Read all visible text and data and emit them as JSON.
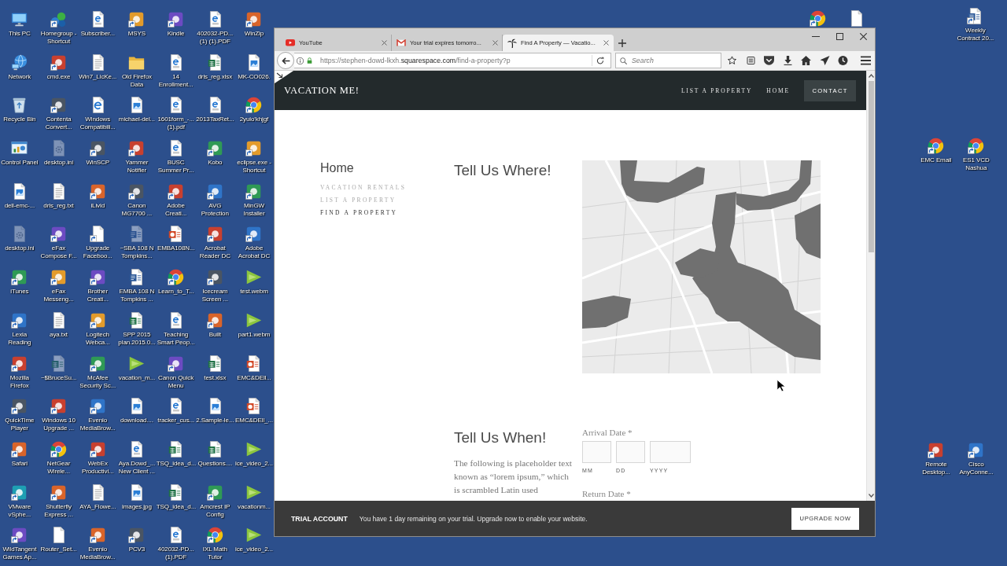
{
  "desktop": {
    "icons": [
      {
        "label": "This PC",
        "kind": "computer",
        "shortcut": false,
        "hidden": false
      },
      {
        "label": "Homegroup - Shortcut",
        "kind": "homegroup",
        "shortcut": true,
        "hidden": false
      },
      {
        "label": "Subscriber...",
        "kind": "pdf",
        "shortcut": false,
        "hidden": false
      },
      {
        "label": "MSYS",
        "kind": "app",
        "shortcut": true,
        "hidden": false
      },
      {
        "label": "Kindle",
        "kind": "app",
        "shortcut": true,
        "hidden": false
      },
      {
        "label": "402032-PD... (1) (1).PDF",
        "kind": "pdf",
        "shortcut": false,
        "hidden": false
      },
      {
        "label": "WinZip",
        "kind": "app",
        "shortcut": true,
        "hidden": false
      },
      {
        "label": "Network",
        "kind": "network",
        "shortcut": false,
        "hidden": false
      },
      {
        "label": "cmd.exe",
        "kind": "app",
        "shortcut": true,
        "hidden": false
      },
      {
        "label": "Win7_LicKe...",
        "kind": "txt",
        "shortcut": false,
        "hidden": false
      },
      {
        "label": "Old Firefox Data",
        "kind": "folder",
        "shortcut": false,
        "hidden": false
      },
      {
        "label": "14 Enrollment...",
        "kind": "pdf",
        "shortcut": false,
        "hidden": false
      },
      {
        "label": "drls_reg.xlsx",
        "kind": "xlsx",
        "shortcut": false,
        "hidden": false
      },
      {
        "label": "MK-CO026.",
        "kind": "image",
        "shortcut": false,
        "hidden": false
      },
      {
        "label": "Recycle Bin",
        "kind": "recycle",
        "shortcut": false,
        "hidden": false
      },
      {
        "label": "Contenta Convert...",
        "kind": "app",
        "shortcut": true,
        "hidden": false
      },
      {
        "label": "Windows Compatibili...",
        "kind": "html",
        "shortcut": false,
        "hidden": false
      },
      {
        "label": "michael-del...",
        "kind": "image",
        "shortcut": false,
        "hidden": false
      },
      {
        "label": "1601form_-... (1).pdf",
        "kind": "pdf",
        "shortcut": false,
        "hidden": false
      },
      {
        "label": "2013TaxRet...",
        "kind": "pdf",
        "shortcut": false,
        "hidden": false
      },
      {
        "label": "2yuio'khjgf",
        "kind": "chrome",
        "shortcut": true,
        "hidden": false
      },
      {
        "label": "Control Panel",
        "kind": "control",
        "shortcut": false,
        "hidden": false
      },
      {
        "label": "desktop.ini",
        "kind": "ini",
        "shortcut": false,
        "hidden": true
      },
      {
        "label": "WinSCP",
        "kind": "app",
        "shortcut": true,
        "hidden": false
      },
      {
        "label": "Yammer Notifier",
        "kind": "app",
        "shortcut": true,
        "hidden": false
      },
      {
        "label": "BUSC Summer Pr...",
        "kind": "pdf",
        "shortcut": false,
        "hidden": false
      },
      {
        "label": "Kobo",
        "kind": "app",
        "shortcut": true,
        "hidden": false
      },
      {
        "label": "eclipse.exe - Shortcut",
        "kind": "app",
        "shortcut": true,
        "hidden": false
      },
      {
        "label": "dell-emc-...",
        "kind": "image",
        "shortcut": false,
        "hidden": false
      },
      {
        "label": "drls_reg.txt",
        "kind": "txt",
        "shortcut": false,
        "hidden": false
      },
      {
        "label": "iLivid",
        "kind": "app",
        "shortcut": true,
        "hidden": false
      },
      {
        "label": "Canon MG7700 ...",
        "kind": "app",
        "shortcut": true,
        "hidden": false
      },
      {
        "label": "Adobe Creati...",
        "kind": "app",
        "shortcut": true,
        "hidden": false
      },
      {
        "label": "AVG Protection",
        "kind": "app",
        "shortcut": true,
        "hidden": false
      },
      {
        "label": "MinGW Installer",
        "kind": "app",
        "shortcut": true,
        "hidden": false
      },
      {
        "label": "desktop.ini",
        "kind": "ini",
        "shortcut": false,
        "hidden": true
      },
      {
        "label": "eFax Compose F...",
        "kind": "app",
        "shortcut": true,
        "hidden": false
      },
      {
        "label": "Upgrade Faceboo...",
        "kind": "file",
        "shortcut": true,
        "hidden": false
      },
      {
        "label": "~SBA 108 N Tompkins...",
        "kind": "docx",
        "shortcut": false,
        "hidden": true
      },
      {
        "label": "EMBA108N...",
        "kind": "pptx",
        "shortcut": false,
        "hidden": false
      },
      {
        "label": "Acrobat Reader DC",
        "kind": "app",
        "shortcut": true,
        "hidden": false
      },
      {
        "label": "Adobe Acrobat DC",
        "kind": "app",
        "shortcut": true,
        "hidden": false
      },
      {
        "label": "iTunes",
        "kind": "app",
        "shortcut": true,
        "hidden": false
      },
      {
        "label": "eFax Messeng...",
        "kind": "app",
        "shortcut": true,
        "hidden": false
      },
      {
        "label": "Brother Creati...",
        "kind": "app",
        "shortcut": true,
        "hidden": false
      },
      {
        "label": "EMBA 108 N Tompkins ...",
        "kind": "docx",
        "shortcut": false,
        "hidden": false
      },
      {
        "label": "Learn_to_T...",
        "kind": "chrome",
        "shortcut": true,
        "hidden": false
      },
      {
        "label": "Icecream Screen ...",
        "kind": "app",
        "shortcut": true,
        "hidden": false
      },
      {
        "label": "test.webm",
        "kind": "video",
        "shortcut": false,
        "hidden": false
      },
      {
        "label": "Lexia Reading",
        "kind": "app",
        "shortcut": true,
        "hidden": false
      },
      {
        "label": "aya.txt",
        "kind": "txt",
        "shortcut": false,
        "hidden": false
      },
      {
        "label": "Logitech Webca...",
        "kind": "app",
        "shortcut": true,
        "hidden": false
      },
      {
        "label": "SPP 2015 plan.2015.0...",
        "kind": "xlsx",
        "shortcut": false,
        "hidden": false
      },
      {
        "label": "Teaching Smart Peop...",
        "kind": "pdf",
        "shortcut": false,
        "hidden": false
      },
      {
        "label": "Built",
        "kind": "app",
        "shortcut": true,
        "hidden": false
      },
      {
        "label": "part1.webm",
        "kind": "video",
        "shortcut": false,
        "hidden": false
      },
      {
        "label": "Mozilla Firefox",
        "kind": "app",
        "shortcut": true,
        "hidden": false
      },
      {
        "label": "~$BruceSu...",
        "kind": "xlsx",
        "shortcut": false,
        "hidden": true
      },
      {
        "label": "McAfee Security Sc...",
        "kind": "app",
        "shortcut": true,
        "hidden": false
      },
      {
        "label": "vacation_m...",
        "kind": "video",
        "shortcut": false,
        "hidden": false
      },
      {
        "label": "Canon Quick Menu",
        "kind": "app",
        "shortcut": true,
        "hidden": false
      },
      {
        "label": "test.xlsx",
        "kind": "xlsx",
        "shortcut": false,
        "hidden": false
      },
      {
        "label": "EMC&DEll...",
        "kind": "pptx",
        "shortcut": false,
        "hidden": false
      },
      {
        "label": "QuickTime Player",
        "kind": "app",
        "shortcut": true,
        "hidden": false
      },
      {
        "label": "Windows 10 Upgrade ...",
        "kind": "app",
        "shortcut": true,
        "hidden": false
      },
      {
        "label": "Evenio MediaBrow...",
        "kind": "app",
        "shortcut": true,
        "hidden": false
      },
      {
        "label": "download....",
        "kind": "image",
        "shortcut": false,
        "hidden": false
      },
      {
        "label": "tracker_cus...",
        "kind": "pdf",
        "shortcut": false,
        "hidden": false
      },
      {
        "label": "2.Sample-le...",
        "kind": "image",
        "shortcut": false,
        "hidden": false
      },
      {
        "label": "EMC&DEll_...",
        "kind": "pptx",
        "shortcut": false,
        "hidden": false
      },
      {
        "label": "Safari",
        "kind": "app",
        "shortcut": true,
        "hidden": false
      },
      {
        "label": "NetGear Wirele...",
        "kind": "chrome",
        "shortcut": true,
        "hidden": false
      },
      {
        "label": "WebEx Productivi...",
        "kind": "app",
        "shortcut": true,
        "hidden": false
      },
      {
        "label": "Aya.Dowd_... New Client ...",
        "kind": "pdf",
        "shortcut": false,
        "hidden": false
      },
      {
        "label": "TSQ_idea_d...",
        "kind": "xlsx",
        "shortcut": false,
        "hidden": false
      },
      {
        "label": "Questions....",
        "kind": "xlsx",
        "shortcut": false,
        "hidden": false
      },
      {
        "label": "ice_video_2...",
        "kind": "video",
        "shortcut": false,
        "hidden": false
      },
      {
        "label": "VMware vSphe...",
        "kind": "app",
        "shortcut": true,
        "hidden": false
      },
      {
        "label": "Shutterfly Express ...",
        "kind": "app",
        "shortcut": true,
        "hidden": false
      },
      {
        "label": "AYA_Flowe...",
        "kind": "txt",
        "shortcut": false,
        "hidden": false
      },
      {
        "label": "images.jpg",
        "kind": "image",
        "shortcut": false,
        "hidden": false
      },
      {
        "label": "TSQ_idea_d...",
        "kind": "xlsx",
        "shortcut": false,
        "hidden": false
      },
      {
        "label": "Amcrest IP Config",
        "kind": "app",
        "shortcut": true,
        "hidden": false
      },
      {
        "label": "vacationm...",
        "kind": "video",
        "shortcut": false,
        "hidden": false
      },
      {
        "label": "WildTangent Games Ap...",
        "kind": "app",
        "shortcut": true,
        "hidden": false
      },
      {
        "label": "Router_Set...",
        "kind": "file",
        "shortcut": false,
        "hidden": false
      },
      {
        "label": "Evenio MediaBrow...",
        "kind": "app",
        "shortcut": true,
        "hidden": false
      },
      {
        "label": "PCV3",
        "kind": "app",
        "shortcut": true,
        "hidden": false
      },
      {
        "label": "402032-PD... (1).PDF",
        "kind": "pdf",
        "shortcut": false,
        "hidden": false
      },
      {
        "label": "IXL Math Tutor",
        "kind": "chrome",
        "shortcut": true,
        "hidden": false
      },
      {
        "label": "ice_video_2...",
        "kind": "video",
        "shortcut": false,
        "hidden": false
      }
    ],
    "right_icons": [
      {
        "kind": "chrome",
        "shortcut": true,
        "hidden": false
      },
      {
        "kind": "file",
        "shortcut": false,
        "hidden": false
      },
      {
        "label": "Weekly Contract 20...",
        "kind": "docx",
        "shortcut": true,
        "hidden": false
      },
      {
        "label": "EMC Email",
        "kind": "chrome",
        "shortcut": true,
        "hidden": false
      },
      {
        "label": "ES1 VCD Nashua",
        "kind": "chrome",
        "shortcut": true,
        "hidden": false
      },
      {
        "label": "Remote Desktop...",
        "kind": "app",
        "shortcut": true,
        "hidden": false
      },
      {
        "label": "Cisco AnyConne...",
        "kind": "app",
        "shortcut": true,
        "hidden": false
      }
    ]
  },
  "browser": {
    "tabs": [
      {
        "title": "YouTube",
        "kind": "video",
        "selected": false
      },
      {
        "title": "Your trial expires tomorro...",
        "kind": "mail",
        "selected": false
      },
      {
        "title": "Find A Property — Vacatio...",
        "kind": "page",
        "selected": true
      }
    ],
    "address": "https://stephen-dowd-lkxh.**squarespace.com**/find-a-property?p",
    "search": {
      "placeholder": "Search"
    }
  },
  "site": {
    "title": "VACATION ME!",
    "nav": [
      {
        "label": "LIST A PROPERTY",
        "kind": "link"
      },
      {
        "label": "HOME",
        "kind": "link"
      },
      {
        "label": "CONTACT",
        "kind": "button"
      }
    ],
    "sidebar": {
      "heading": "Home",
      "items": [
        {
          "label": "VACATION RENTALS",
          "selected": false
        },
        {
          "label": "LIST A PROPERTY",
          "selected": false
        },
        {
          "label": "FIND A PROPERTY",
          "selected": true
        }
      ]
    },
    "where": {
      "title": "Tell Us Where!"
    },
    "when": {
      "title": "Tell Us When!",
      "text": "The following is placeholder text known as “lorem ipsum,” which is scrambled Latin used",
      "arrival": {
        "label": "Arrival Date *",
        "fields": [
          {
            "caption": "MM"
          },
          {
            "caption": "DD"
          },
          {
            "caption": "YYYY"
          }
        ]
      },
      "return": {
        "label": "Return Date *"
      }
    }
  },
  "trial_bar": {
    "title": "TRIAL ACCOUNT",
    "message": "You have 1 day remaining on your trial. Upgrade now to enable your website.",
    "button": "UPGRADE NOW"
  }
}
